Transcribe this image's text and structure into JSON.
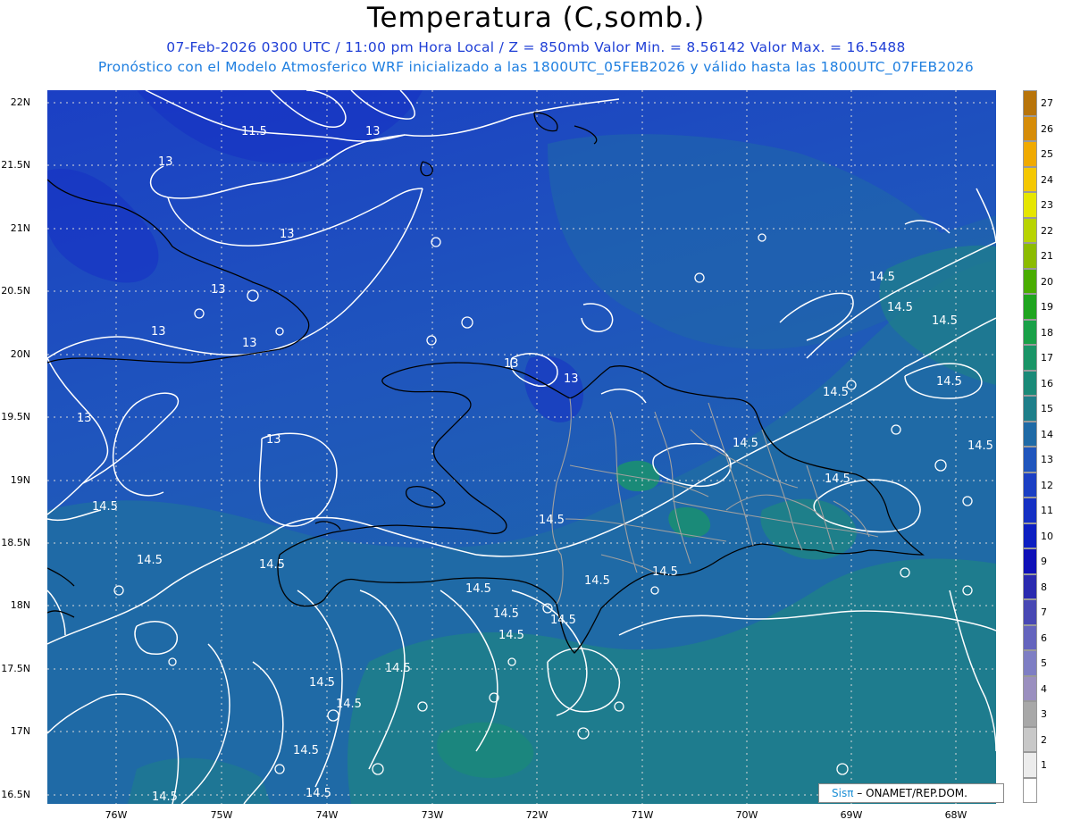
{
  "header": {
    "title": "Temperatura (C,somb.)",
    "line1": "07-Feb-2026  0300 UTC / 11:00 pm Hora Local / Z = 850mb    Valor Min. = 8.56142  Valor Max. = 16.5488",
    "line2": "Pronóstico con el Modelo Atmosferico WRF inicializado a las 1800UTC_05FEB2026 y válido hasta las  1800UTC_07FEB2026"
  },
  "axes": {
    "lat_labels": [
      "22N",
      "21.5N",
      "21N",
      "20.5N",
      "20N",
      "19.5N",
      "19N",
      "18.5N",
      "18N",
      "17.5N",
      "17N",
      "16.5N"
    ],
    "lon_labels": [
      "76W",
      "75W",
      "74W",
      "73W",
      "72W",
      "71W",
      "70W",
      "69W",
      "68W"
    ]
  },
  "contour_labels": [
    {
      "text": "11.5"
    },
    {
      "text": "13"
    },
    {
      "text": "13"
    },
    {
      "text": "13"
    },
    {
      "text": "13"
    },
    {
      "text": "13"
    },
    {
      "text": "13"
    },
    {
      "text": "13"
    },
    {
      "text": "13"
    },
    {
      "text": "13"
    },
    {
      "text": "13"
    },
    {
      "text": "14.5"
    },
    {
      "text": "14.5"
    },
    {
      "text": "14.5"
    },
    {
      "text": "14.5"
    },
    {
      "text": "14.5"
    },
    {
      "text": "14.5"
    },
    {
      "text": "14.5"
    },
    {
      "text": "14.5"
    },
    {
      "text": "14.5"
    },
    {
      "text": "14.5"
    },
    {
      "text": "14.5"
    },
    {
      "text": "14.5"
    },
    {
      "text": "14.5"
    },
    {
      "text": "14.5"
    },
    {
      "text": "14.5"
    },
    {
      "text": "14.5"
    },
    {
      "text": "14.5"
    },
    {
      "text": "14.5"
    },
    {
      "text": "14.5"
    },
    {
      "text": "14.5"
    },
    {
      "text": "14.5"
    },
    {
      "text": "14.5"
    },
    {
      "text": "14.5"
    },
    {
      "text": "14.5"
    }
  ],
  "colorbar": {
    "levels": [
      {
        "label": "27",
        "color": "#b8740a"
      },
      {
        "label": "26",
        "color": "#d68c08"
      },
      {
        "label": "25",
        "color": "#f0aa00"
      },
      {
        "label": "24",
        "color": "#f5c800"
      },
      {
        "label": "23",
        "color": "#e6e600"
      },
      {
        "label": "22",
        "color": "#b8d400"
      },
      {
        "label": "21",
        "color": "#8cbc00"
      },
      {
        "label": "20",
        "color": "#49ad00"
      },
      {
        "label": "19",
        "color": "#1fa51f"
      },
      {
        "label": "18",
        "color": "#19a148"
      },
      {
        "label": "17",
        "color": "#1a9567"
      },
      {
        "label": "16",
        "color": "#1a8a78"
      },
      {
        "label": "15",
        "color": "#1e7f8a"
      },
      {
        "label": "14",
        "color": "#1f6aa6"
      },
      {
        "label": "13",
        "color": "#1f55bd"
      },
      {
        "label": "12",
        "color": "#1b3fc4"
      },
      {
        "label": "11",
        "color": "#1530c4"
      },
      {
        "label": "10",
        "color": "#0d1fc2"
      },
      {
        "label": "9",
        "color": "#0f10b8"
      },
      {
        "label": "8",
        "color": "#2a2ab0"
      },
      {
        "label": "7",
        "color": "#4848b4"
      },
      {
        "label": "6",
        "color": "#6464be"
      },
      {
        "label": "5",
        "color": "#7e7ec4"
      },
      {
        "label": "4",
        "color": "#9a8fbf"
      },
      {
        "label": "3",
        "color": "#a8a8a8"
      },
      {
        "label": "2",
        "color": "#c8c8c8"
      },
      {
        "label": "1",
        "color": "#ececec"
      },
      {
        "label": "",
        "color": "#ffffff"
      }
    ]
  },
  "credit": {
    "sis": "Sisπ",
    "text": "– ONAMET/REP.DOM."
  },
  "colors": {
    "ocean": "#1f55bd",
    "contour": "#ffffff",
    "coast": "#000000",
    "province": "#a0a0a0",
    "title_blue": "#1f3fd6",
    "subtitle_blue": "#1f7fe0"
  }
}
